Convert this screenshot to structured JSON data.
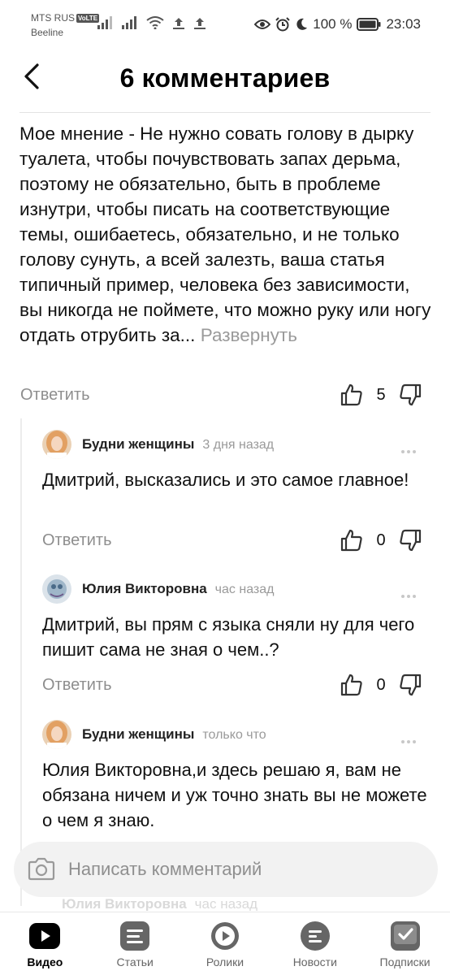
{
  "status_bar": {
    "carrier_primary": "MTS RUS",
    "volte": "VoLTE",
    "carrier_secondary": "Beeline",
    "battery": "100 %",
    "time": "23:03"
  },
  "header": {
    "title": "6 комментариев"
  },
  "main_comment": {
    "text": "Мое мнение - Не нужно совать голову в дырку туалета, чтобы почувствовать запах дерьма, поэтому не обязательно, быть в проблеме изнутри, чтобы писать на соответствующие темы, ошибаетесь, обязательно, и не только голову сунуть, а всей залезть, ваша статья типичный пример, человека без зависимости, вы никогда не поймете, что можно руку или ногу отдать отрубить за...",
    "expand_label": "Развернуть",
    "reply_label": "Ответить",
    "likes": "5"
  },
  "replies": [
    {
      "author": "Будни женщины",
      "time": "3 дня назад",
      "text": "Дмитрий, высказались и это самое главное!",
      "reply_label": "Ответить",
      "likes": "0"
    },
    {
      "author": "Юлия Викторовна",
      "time": "час назад",
      "text": "Дмитрий, вы прям с языка сняли ну для чего пишит сама не зная о  чем..?",
      "reply_label": "Ответить",
      "likes": "0"
    },
    {
      "author": "Будни женщины",
      "time": "только что",
      "text": "Юлия Викторовна,и здесь решаю я, вам не обязана ничем и уж точно знать вы не можете о чем я знаю."
    }
  ],
  "ghost_reply": {
    "author": "Юлия Викторовна",
    "time": "час назад"
  },
  "comment_input": {
    "placeholder": "Написать комментарий"
  },
  "tabs": [
    {
      "label": "Видео",
      "icon": "video-icon",
      "active": true
    },
    {
      "label": "Статьи",
      "icon": "articles-icon",
      "active": false
    },
    {
      "label": "Ролики",
      "icon": "shorts-icon",
      "active": false
    },
    {
      "label": "Новости",
      "icon": "news-icon",
      "active": false
    },
    {
      "label": "Подписки",
      "icon": "subscriptions-icon",
      "active": false
    }
  ]
}
